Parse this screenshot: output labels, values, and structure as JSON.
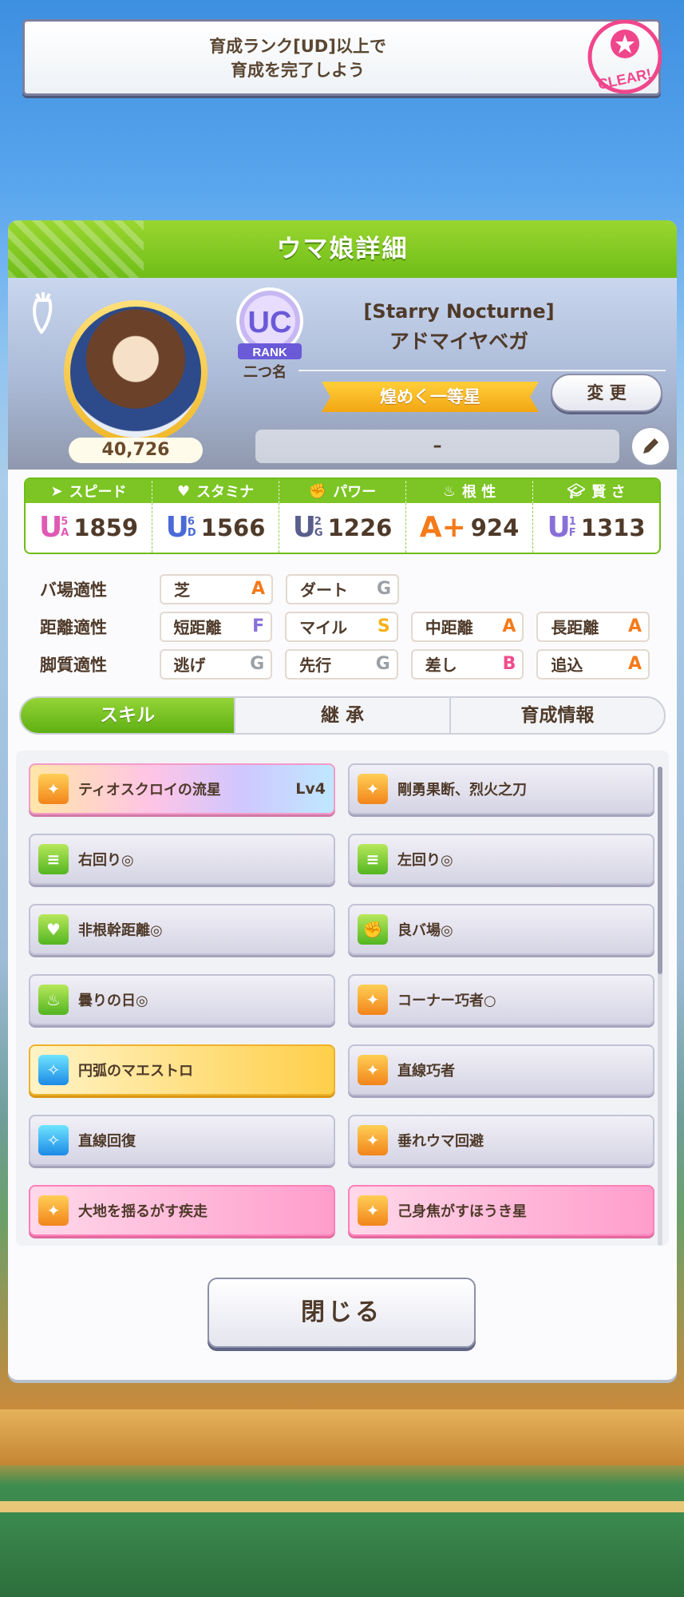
{
  "banner": {
    "line1": "育成ランク[UD]以上で",
    "line2": "育成を完了しよう",
    "badge": "CLEAR!"
  },
  "header": {
    "title": "ウマ娘詳細"
  },
  "profile": {
    "score": "40,726",
    "rank_badge": "UC",
    "rank_label": "RANK",
    "nickname_label": "二つ名",
    "outfit": "[Starry Nocturne]",
    "name": "アドマイヤベガ",
    "epithet": "煌めく一等星",
    "change_label": "変 更",
    "memo": "–"
  },
  "stats": [
    {
      "label": "スピード",
      "grade": "U",
      "sub1": "5",
      "sub2": "A",
      "value": "1859",
      "icon": "shoe-icon",
      "color": "#e05ab4"
    },
    {
      "label": "スタミナ",
      "grade": "U",
      "sub1": "6",
      "sub2": "D",
      "value": "1566",
      "icon": "heart-icon",
      "color": "#4a6ad8"
    },
    {
      "label": "パワー",
      "grade": "U",
      "sub1": "2",
      "sub2": "G",
      "value": "1226",
      "icon": "arm-icon",
      "color": "#5a5e8c"
    },
    {
      "label": "根 性",
      "grade": "A+",
      "sub1": "",
      "sub2": "",
      "value": "924",
      "icon": "flame-icon",
      "color": "#f47a1a"
    },
    {
      "label": "賢 さ",
      "grade": "U",
      "sub1": "1",
      "sub2": "F",
      "value": "1313",
      "icon": "cap-icon",
      "color": "#8870d8"
    }
  ],
  "aptitude": {
    "track_label": "バ場適性",
    "distance_label": "距離適性",
    "style_label": "脚質適性",
    "track": [
      {
        "name": "芝",
        "grade": "A"
      },
      {
        "name": "ダート",
        "grade": "G"
      }
    ],
    "distance": [
      {
        "name": "短距離",
        "grade": "F"
      },
      {
        "name": "マイル",
        "grade": "S"
      },
      {
        "name": "中距離",
        "grade": "A"
      },
      {
        "name": "長距離",
        "grade": "A"
      }
    ],
    "style": [
      {
        "name": "逃げ",
        "grade": "G"
      },
      {
        "name": "先行",
        "grade": "G"
      },
      {
        "name": "差し",
        "grade": "B"
      },
      {
        "name": "追込",
        "grade": "A"
      }
    ]
  },
  "tabs": [
    {
      "label": "スキル"
    },
    {
      "label": "継 承"
    },
    {
      "label": "育成情報"
    }
  ],
  "skills": [
    {
      "name": "ティオスクロイの流星",
      "level": "Lv4",
      "style": "rainbow",
      "icon": "ic-orange"
    },
    {
      "name": "剛勇果断、烈火之刀",
      "level": "",
      "style": "plain",
      "icon": "ic-orange"
    },
    {
      "name": "右回り◎",
      "level": "",
      "style": "plain",
      "icon": "ic-green"
    },
    {
      "name": "左回り◎",
      "level": "",
      "style": "plain",
      "icon": "ic-green"
    },
    {
      "name": "非根幹距離◎",
      "level": "",
      "style": "plain",
      "icon": "ic-green"
    },
    {
      "name": "良バ場◎",
      "level": "",
      "style": "plain",
      "icon": "ic-green"
    },
    {
      "name": "曇りの日◎",
      "level": "",
      "style": "plain",
      "icon": "ic-green"
    },
    {
      "name": "コーナー巧者○",
      "level": "",
      "style": "plain",
      "icon": "ic-orange"
    },
    {
      "name": "円弧のマエストロ",
      "level": "",
      "style": "gold",
      "icon": "ic-blue"
    },
    {
      "name": "直線巧者",
      "level": "",
      "style": "plain",
      "icon": "ic-orange"
    },
    {
      "name": "直線回復",
      "level": "",
      "style": "plain",
      "icon": "ic-blue"
    },
    {
      "name": "垂れウマ回避",
      "level": "",
      "style": "plain",
      "icon": "ic-orange"
    },
    {
      "name": "大地を揺るがす疾走",
      "level": "",
      "style": "pink",
      "icon": "ic-orange"
    },
    {
      "name": "己身焦がすほうき星",
      "level": "",
      "style": "pink",
      "icon": "ic-orange"
    }
  ],
  "close_label": "閉じる"
}
